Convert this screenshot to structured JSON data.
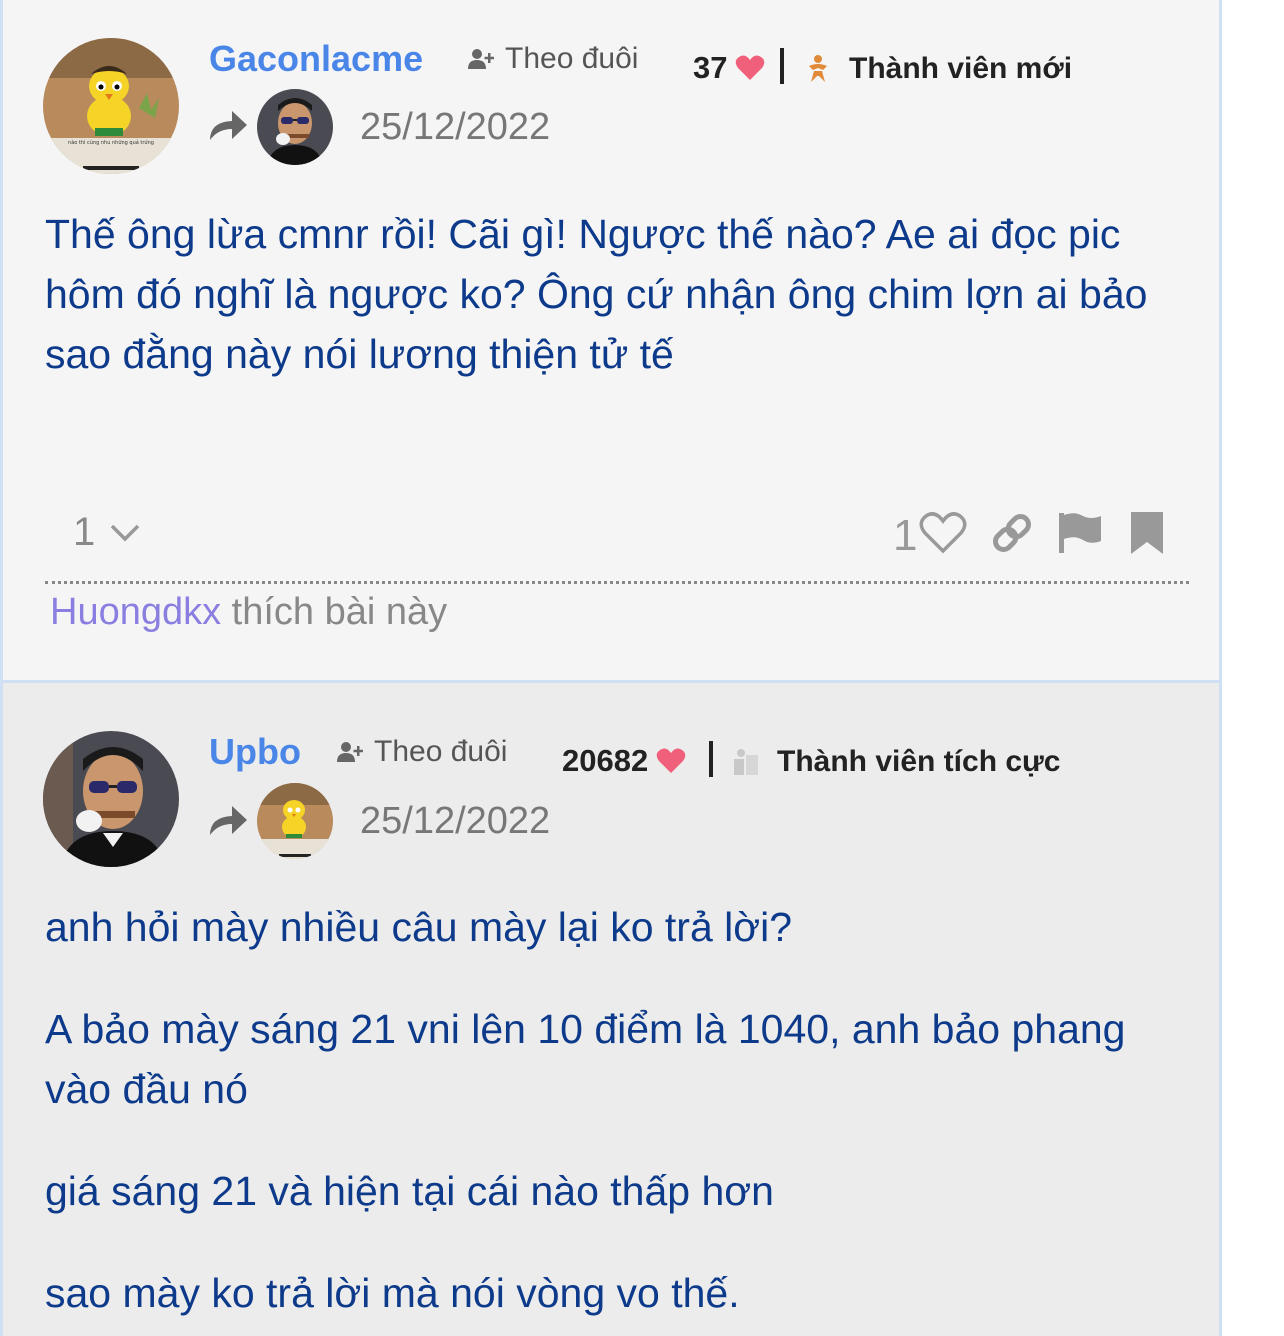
{
  "posts": [
    {
      "username": "Gaconlacme",
      "follow_label": "Theo đuôi",
      "like_total": "37",
      "rank": "Thành viên mới",
      "date": "25/12/2022",
      "paragraphs": [
        "Thế ông lừa cmnr rồi! Cãi gì! Ngược thế nào? Ae ai đọc pic hôm đó nghĩ là ngược ko? Ông cứ nhận ông chim lợn ai bảo sao đằng này nói lương thiện tử tế"
      ],
      "reply_count": "1",
      "like_count": "1",
      "liked_by_user": "Huongdkx",
      "liked_by_suffix": " thích bài này",
      "avatar_caption": "nào thì cùng nhu những quả trứng"
    },
    {
      "username": "Upbo",
      "follow_label": "Theo đuôi",
      "like_total": "20682",
      "rank": "Thành viên tích cực",
      "date": "25/12/2022",
      "paragraphs": [
        "anh hỏi mày nhiều câu mày lại ko trả lời?",
        "A bảo mày sáng 21 vni lên 10 điểm là 1040, anh bảo phang vào đầu nó",
        "giá sáng 21 và hiện tại cái nào thấp hơn",
        "sao mày ko trả lời mà nói vòng vo thế."
      ]
    }
  ],
  "colors": {
    "username": "#4a86e8",
    "content_text": "#0d3a8a",
    "heart": "#f0607a",
    "liked_by_name": "#8a7fe0"
  },
  "icons": [
    "follow-user-icon",
    "heart-icon",
    "rank-new-member-icon",
    "rank-active-member-icon",
    "reply-arrow-icon",
    "chevron-down-icon",
    "heart-outline-icon",
    "link-icon",
    "flag-icon",
    "bookmark-icon"
  ]
}
